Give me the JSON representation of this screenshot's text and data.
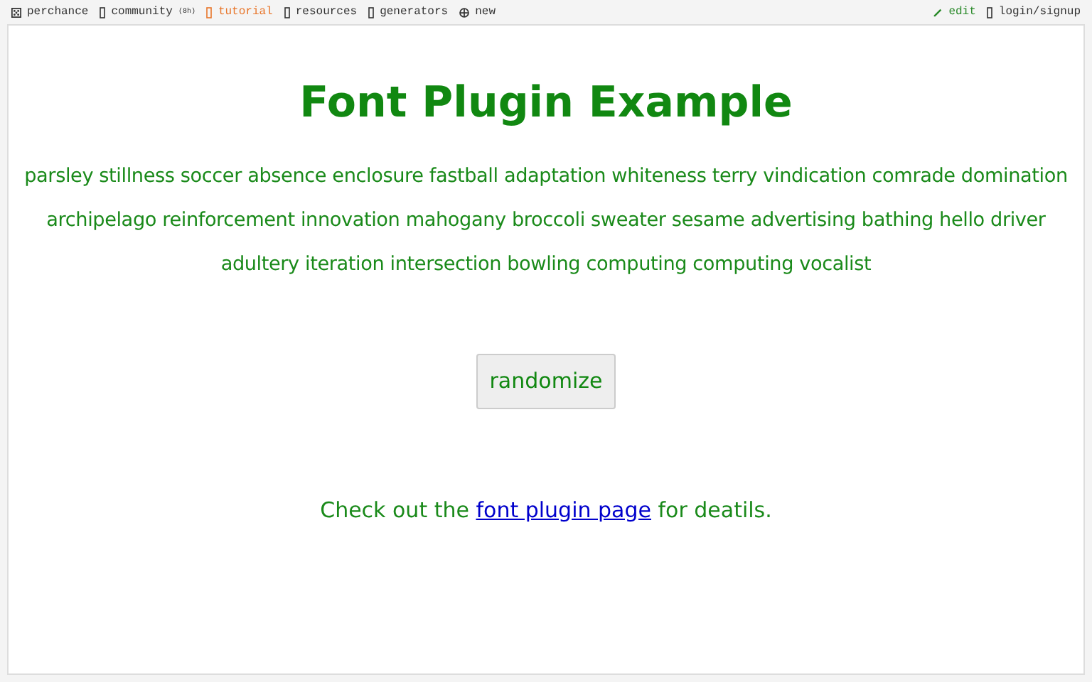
{
  "nav": {
    "left": [
      {
        "label": "perchance",
        "selected": false,
        "kind": "dice"
      },
      {
        "label": "community",
        "badge": "(8h)",
        "selected": false,
        "kind": "box"
      },
      {
        "label": "tutorial",
        "selected": true,
        "kind": "box"
      },
      {
        "label": "resources",
        "selected": false,
        "kind": "box"
      },
      {
        "label": "generators",
        "selected": false,
        "kind": "box"
      },
      {
        "label": "new",
        "selected": false,
        "kind": "plus"
      }
    ],
    "right": [
      {
        "label": "edit",
        "selected": false,
        "kind": "pencil"
      },
      {
        "label": "login/signup",
        "selected": false,
        "kind": "box"
      }
    ]
  },
  "page": {
    "title": "Font Plugin Example",
    "words": "parsley stillness soccer absence enclosure fastball adaptation whiteness terry vindication comrade domination archipelago reinforcement innovation mahogany broccoli sweater sesame advertising bathing hello driver adultery iteration intersection bowling computing computing vocalist",
    "button": "randomize",
    "footer_before": "Check out the",
    "footer_link": "font plugin page",
    "footer_after": "for deatils."
  }
}
